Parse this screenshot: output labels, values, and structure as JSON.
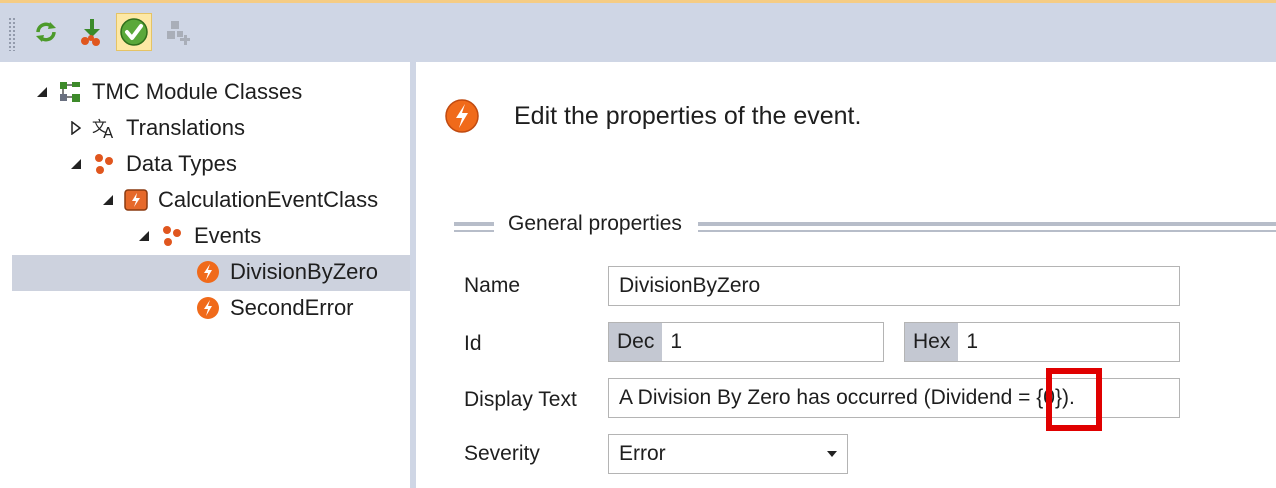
{
  "tree": {
    "root": "TMC Module Classes",
    "translations": "Translations",
    "data_types": "Data Types",
    "calc_class": "CalculationEventClass",
    "events": "Events",
    "event1": "DivisionByZero",
    "event2": "SecondError"
  },
  "panel": {
    "header": "Edit the properties of the event.",
    "group_title": "General properties",
    "name_label": "Name",
    "name_value": "DivisionByZero",
    "id_label": "Id",
    "dec_prefix": "Dec",
    "dec_value": "1",
    "hex_prefix": "Hex",
    "hex_value": "1",
    "display_text_label": "Display Text",
    "display_text_value": "A Division By Zero has occurred (Dividend = {0}).",
    "severity_label": "Severity",
    "severity_value": "Error"
  },
  "icons": {
    "toolbar": [
      "refresh-icon",
      "import-icon",
      "check-icon",
      "add-disabled-icon"
    ]
  },
  "colors": {
    "toolbar_bg": "#cfd6e5",
    "selection": "#cdd2de",
    "highlight_box": "#e00000",
    "event_icon": "#f06a1a"
  }
}
